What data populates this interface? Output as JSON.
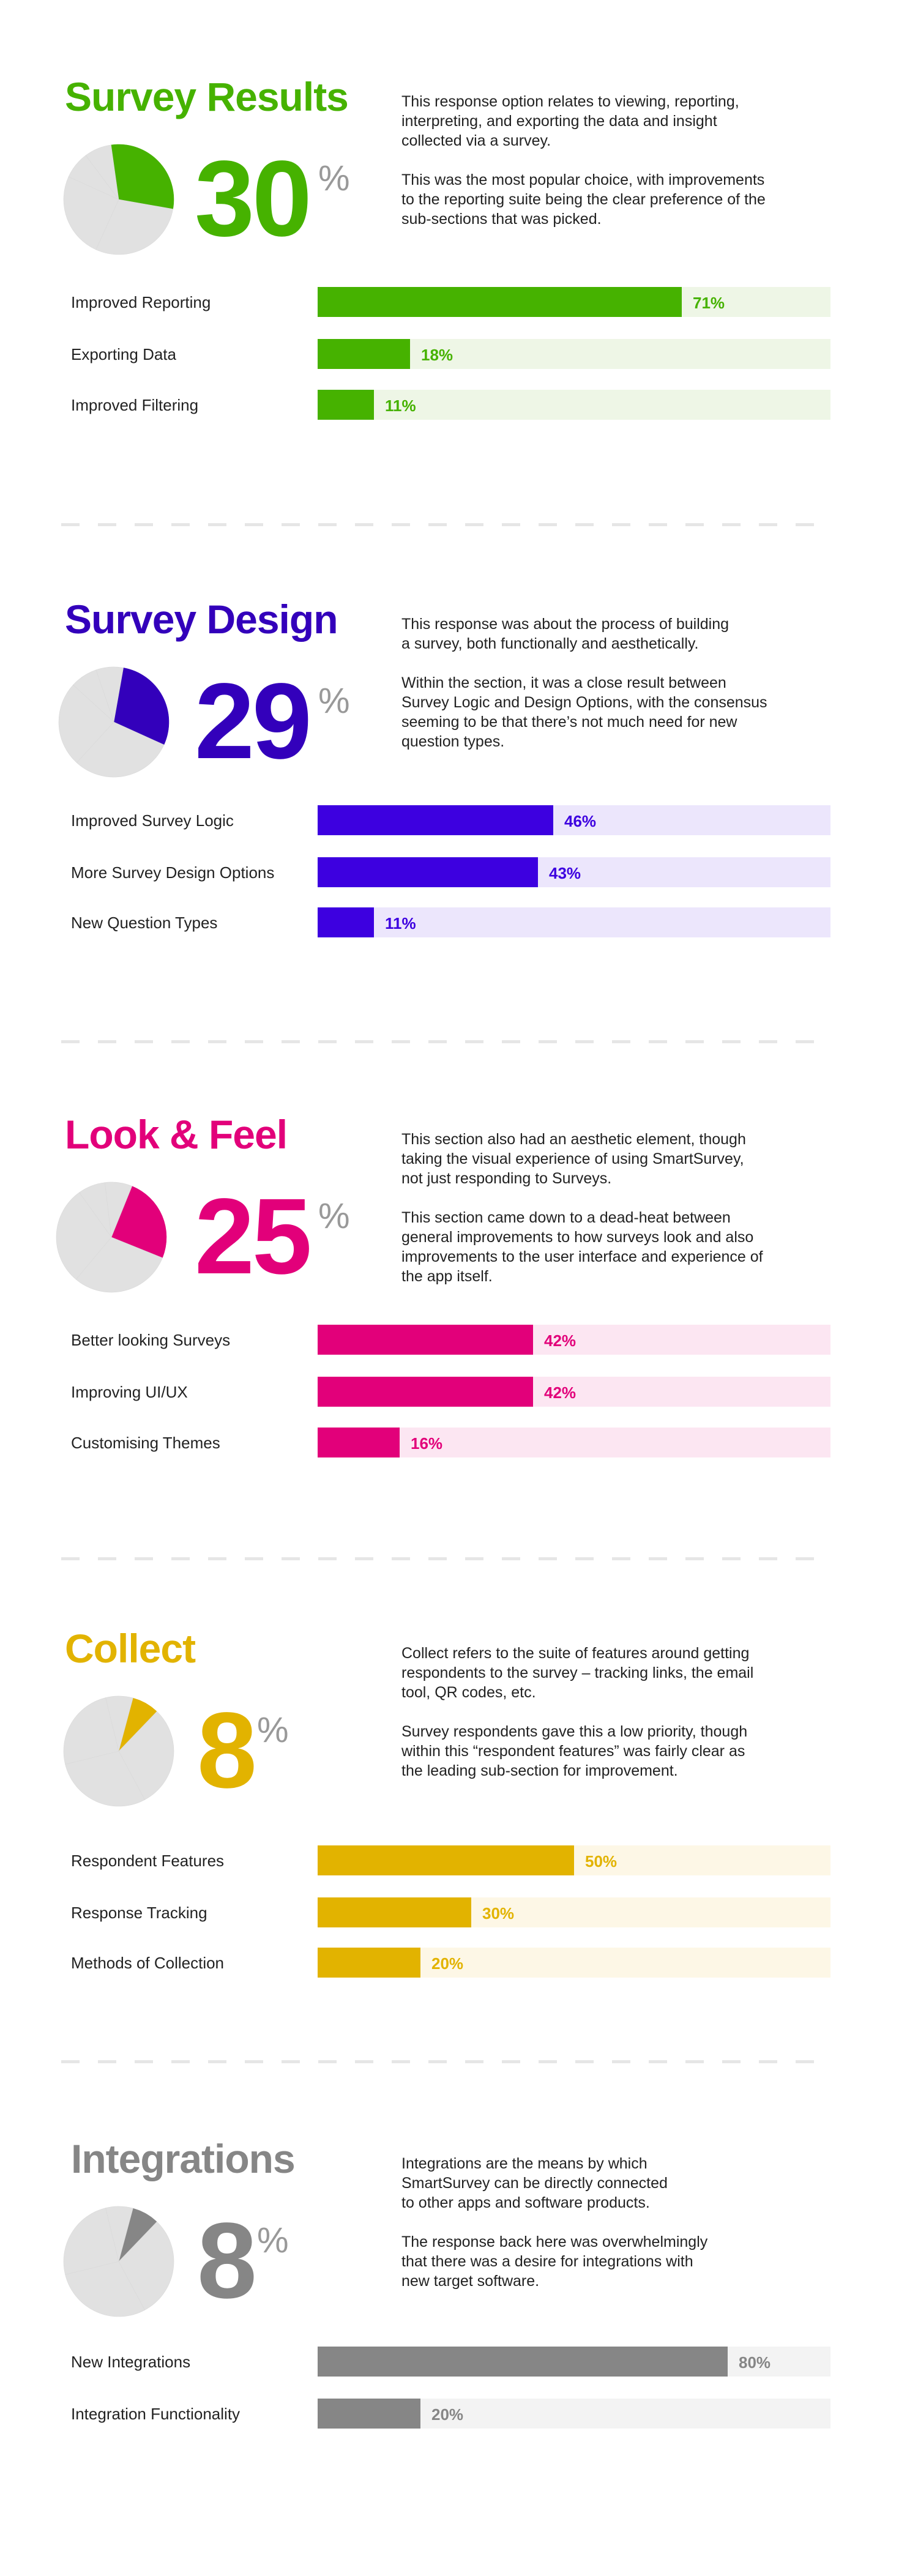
{
  "pie_shares": [
    30,
    29,
    25,
    8,
    8
  ],
  "sections": [
    {
      "id": "survey-results",
      "title": "Survey Results",
      "percent": "30",
      "percent_sign": "%",
      "share": 30,
      "color": "#46b200",
      "track_color": "#eef6e6",
      "description": [
        "This response option relates to viewing, reporting,\ninterpreting, and exporting the data and insight\ncollected via a survey.",
        "This was the most popular choice, with improvements\nto the reporting suite being the clear preference of the\nsub-sections that was picked."
      ],
      "bars": [
        {
          "label": "Improved Reporting",
          "value": 71,
          "value_label": "71%"
        },
        {
          "label": "Exporting Data",
          "value": 18,
          "value_label": "18%"
        },
        {
          "label": "Improved Filtering",
          "value": 11,
          "value_label": "11%"
        }
      ]
    },
    {
      "id": "survey-design",
      "title": "Survey Design",
      "percent": "29",
      "percent_sign": "%",
      "share": 29,
      "color": "#3300bb",
      "bar_color": "#3d00e0",
      "track_color": "#ece6fc",
      "description": [
        "This response was about the process of building\na survey, both functionally and aesthetically.",
        "Within the section, it was a close result between\nSurvey Logic and Design Options, with the consensus\nseeming to be that there’s not much need for new\nquestion types."
      ],
      "bars": [
        {
          "label": "Improved Survey Logic",
          "value": 46,
          "value_label": "46%"
        },
        {
          "label": "More Survey Design Options",
          "value": 43,
          "value_label": "43%"
        },
        {
          "label": "New Question Types",
          "value": 11,
          "value_label": "11%"
        }
      ]
    },
    {
      "id": "look-and-feel",
      "title": "Look & Feel",
      "percent": "25",
      "percent_sign": "%",
      "share": 25,
      "color": "#e2007a",
      "track_color": "#fce6f2",
      "description": [
        "This section also had an aesthetic element, though\ntaking the visual experience of using SmartSurvey,\nnot just responding to Surveys.",
        "This section came down to a dead-heat between\ngeneral improvements to how surveys look and also\nimprovements to the user interface and experience of\nthe app itself."
      ],
      "bars": [
        {
          "label": "Better looking Surveys",
          "value": 42,
          "value_label": "42%"
        },
        {
          "label": "Improving UI/UX",
          "value": 42,
          "value_label": "42%"
        },
        {
          "label": "Customising Themes",
          "value": 16,
          "value_label": "16%"
        }
      ]
    },
    {
      "id": "collect",
      "title": "Collect",
      "percent": "8",
      "percent_sign": "%",
      "share": 8,
      "color": "#e2b300",
      "track_color": "#fdf7e6",
      "description": [
        "Collect refers to the suite of features around getting\nrespondents to the survey – tracking links, the email\ntool, QR codes, etc.",
        "Survey respondents gave this a low priority, though\nwithin this “respondent features” was fairly clear as\nthe leading sub-section for improvement."
      ],
      "bars": [
        {
          "label": "Respondent Features",
          "value": 50,
          "value_label": "50%"
        },
        {
          "label": "Response Tracking",
          "value": 30,
          "value_label": "30%"
        },
        {
          "label": "Methods of Collection",
          "value": 20,
          "value_label": "20%"
        }
      ]
    },
    {
      "id": "integrations",
      "title": "Integrations",
      "percent": "8",
      "percent_sign": "%",
      "share": 8,
      "color": "#868686",
      "track_color": "#f3f3f3",
      "description": [
        "Integrations are the means by which\nSmartSurvey can be directly connected\nto other apps and software products.",
        "The response back here was overwhelmingly\nthat there was a desire for integrations with\nnew target software."
      ],
      "bars": [
        {
          "label": "New Integrations",
          "value": 80,
          "value_label": "80%"
        },
        {
          "label": "Integration Functionality",
          "value": 20,
          "value_label": "20%"
        }
      ]
    }
  ],
  "chart_data": [
    {
      "type": "pie",
      "title": "Survey Results",
      "highlight": "Survey Results",
      "categories": [
        "Survey Results",
        "Survey Design",
        "Look & Feel",
        "Collect",
        "Integrations"
      ],
      "values": [
        30,
        29,
        25,
        8,
        8
      ]
    },
    {
      "type": "bar",
      "orientation": "horizontal",
      "title": "Survey Results",
      "categories": [
        "Improved Reporting",
        "Exporting Data",
        "Improved Filtering"
      ],
      "values": [
        71,
        18,
        11
      ],
      "xlim": [
        0,
        100
      ],
      "unit": "%"
    },
    {
      "type": "pie",
      "title": "Survey Design",
      "highlight": "Survey Design",
      "categories": [
        "Survey Results",
        "Survey Design",
        "Look & Feel",
        "Collect",
        "Integrations"
      ],
      "values": [
        30,
        29,
        25,
        8,
        8
      ]
    },
    {
      "type": "bar",
      "orientation": "horizontal",
      "title": "Survey Design",
      "categories": [
        "Improved Survey Logic",
        "More Survey Design Options",
        "New Question Types"
      ],
      "values": [
        46,
        43,
        11
      ],
      "xlim": [
        0,
        100
      ],
      "unit": "%"
    },
    {
      "type": "pie",
      "title": "Look & Feel",
      "highlight": "Look & Feel",
      "categories": [
        "Survey Results",
        "Survey Design",
        "Look & Feel",
        "Collect",
        "Integrations"
      ],
      "values": [
        30,
        29,
        25,
        8,
        8
      ]
    },
    {
      "type": "bar",
      "orientation": "horizontal",
      "title": "Look & Feel",
      "categories": [
        "Better looking Surveys",
        "Improving UI/UX",
        "Customising Themes"
      ],
      "values": [
        42,
        42,
        16
      ],
      "xlim": [
        0,
        100
      ],
      "unit": "%"
    },
    {
      "type": "pie",
      "title": "Collect",
      "highlight": "Collect",
      "categories": [
        "Survey Results",
        "Survey Design",
        "Look & Feel",
        "Collect",
        "Integrations"
      ],
      "values": [
        30,
        29,
        25,
        8,
        8
      ]
    },
    {
      "type": "bar",
      "orientation": "horizontal",
      "title": "Collect",
      "categories": [
        "Respondent Features",
        "Response Tracking",
        "Methods of Collection"
      ],
      "values": [
        50,
        30,
        20
      ],
      "xlim": [
        0,
        100
      ],
      "unit": "%"
    },
    {
      "type": "pie",
      "title": "Integrations",
      "highlight": "Integrations",
      "categories": [
        "Survey Results",
        "Survey Design",
        "Look & Feel",
        "Collect",
        "Integrations"
      ],
      "values": [
        30,
        29,
        25,
        8,
        8
      ]
    },
    {
      "type": "bar",
      "orientation": "horizontal",
      "title": "Integrations",
      "categories": [
        "New Integrations",
        "Integration Functionality"
      ],
      "values": [
        80,
        20
      ],
      "xlim": [
        0,
        100
      ],
      "unit": "%"
    }
  ]
}
